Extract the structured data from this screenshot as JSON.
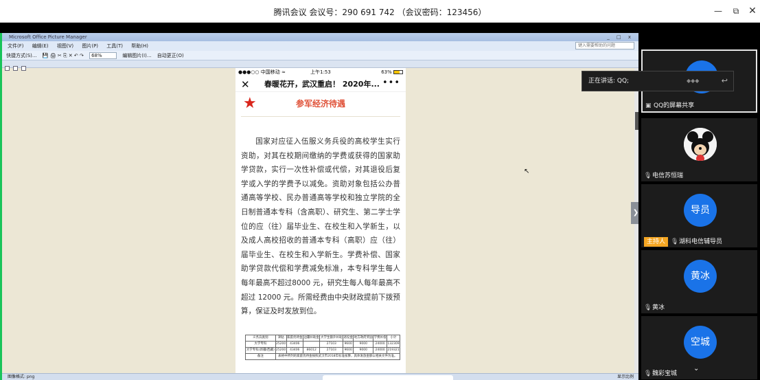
{
  "titlebar": {
    "title": "腾讯会议 会议号：290 691 742 （会议密码：123456）",
    "minimize": "—",
    "restore": "⧉",
    "close": "✕"
  },
  "picture_manager": {
    "caption": "Microsoft Office Picture Manager",
    "caption_buttons": "_ □ x",
    "menu": [
      "文件(F)",
      "编辑(E)",
      "视图(V)",
      "图片(P)",
      "工具(T)",
      "帮助(H)"
    ],
    "search_placeholder": "键入需要帮助的问题",
    "toolbar_left": "快捷方式(S)...",
    "toolbar_icons": "💾 🖨 ✂ ⎘ ✕ ↶ ↷",
    "zoom": "68%",
    "toolbar_edit": "编辑图片(I)...",
    "toolbar_auto": "自动更正(O)",
    "status_left": "图像格式: png",
    "status_right": "显示比例"
  },
  "phone": {
    "carrier": "●●●○○ 中国移动 ≈",
    "time": "上午1:53",
    "battery": "63%",
    "battery_level": 0.63,
    "nav_close": "✕",
    "nav_title": "春暖花开，武汉重启！ 2020年...",
    "nav_more": "•••",
    "heading": "参军经济待遇",
    "body": "国家对应征入伍服义务兵役的高校学生实行资助，对其在校期间缴纳的学费或获得的国家助学贷款，实行一次性补偿或代偿，对其退役后复学或入学的学费予以减免。资助对象包括公办普通高等学校、民办普通高等学校和独立学院的全日制普通本专科（含高职）、研究生、第二学士学位的应（往）届毕业生、在校生和入学新生，以及成人高校招收的普通本专科（高职）应（往）届毕业生、在校生和入学新生。学费补偿、国家助学贷款代偿和学费减免标准，本专科学生每人每年最高不超过8000 元，研究生每人每年最高不超过 12000 元。所需经费由中央财政提前下拨预算，保证及时发放到位。",
    "table": {
      "headers": [
        "义务兵类别",
        "津贴",
        "家庭优待金",
        "边疆补助金",
        "大学生额外补助",
        "退役金",
        "地方政府奖励",
        "学费补偿",
        "小计"
      ],
      "rows": [
        [
          "大学专科",
          "25200",
          "43406",
          "",
          "27103",
          "9600",
          "9000",
          "24000",
          "132309"
        ],
        [
          "大学专科(新疆/西藏)",
          "25200",
          "43406",
          "86012",
          "27103",
          "9600",
          "9000",
          "24000",
          "219321"
        ]
      ],
      "note_label": "备注",
      "note": "表格中所列的家庭优待金按照武汉市2018年标准核算，具体发放金额以相关文件为准。"
    }
  },
  "meeting": {
    "speaking_label": "正在讲话: QQ;",
    "participants": [
      {
        "name": "QQ的屏幕共享",
        "avatar": "",
        "role": ""
      },
      {
        "name": "电信苏恒瑞",
        "avatar": "",
        "role": ""
      },
      {
        "name": "湖科电信辅导员",
        "avatar": "导员",
        "role": "主持人"
      },
      {
        "name": "黄冰",
        "avatar": "黄冰",
        "role": ""
      },
      {
        "name": "魏彩宝城",
        "avatar": "空城",
        "role": ""
      }
    ]
  },
  "colors": {
    "meeting_avatar": "#1a73e8",
    "host_badge": "#f5a623",
    "share_border": "#19c45a",
    "heading_red": "#e0533a",
    "star_red": "#d9261c"
  }
}
